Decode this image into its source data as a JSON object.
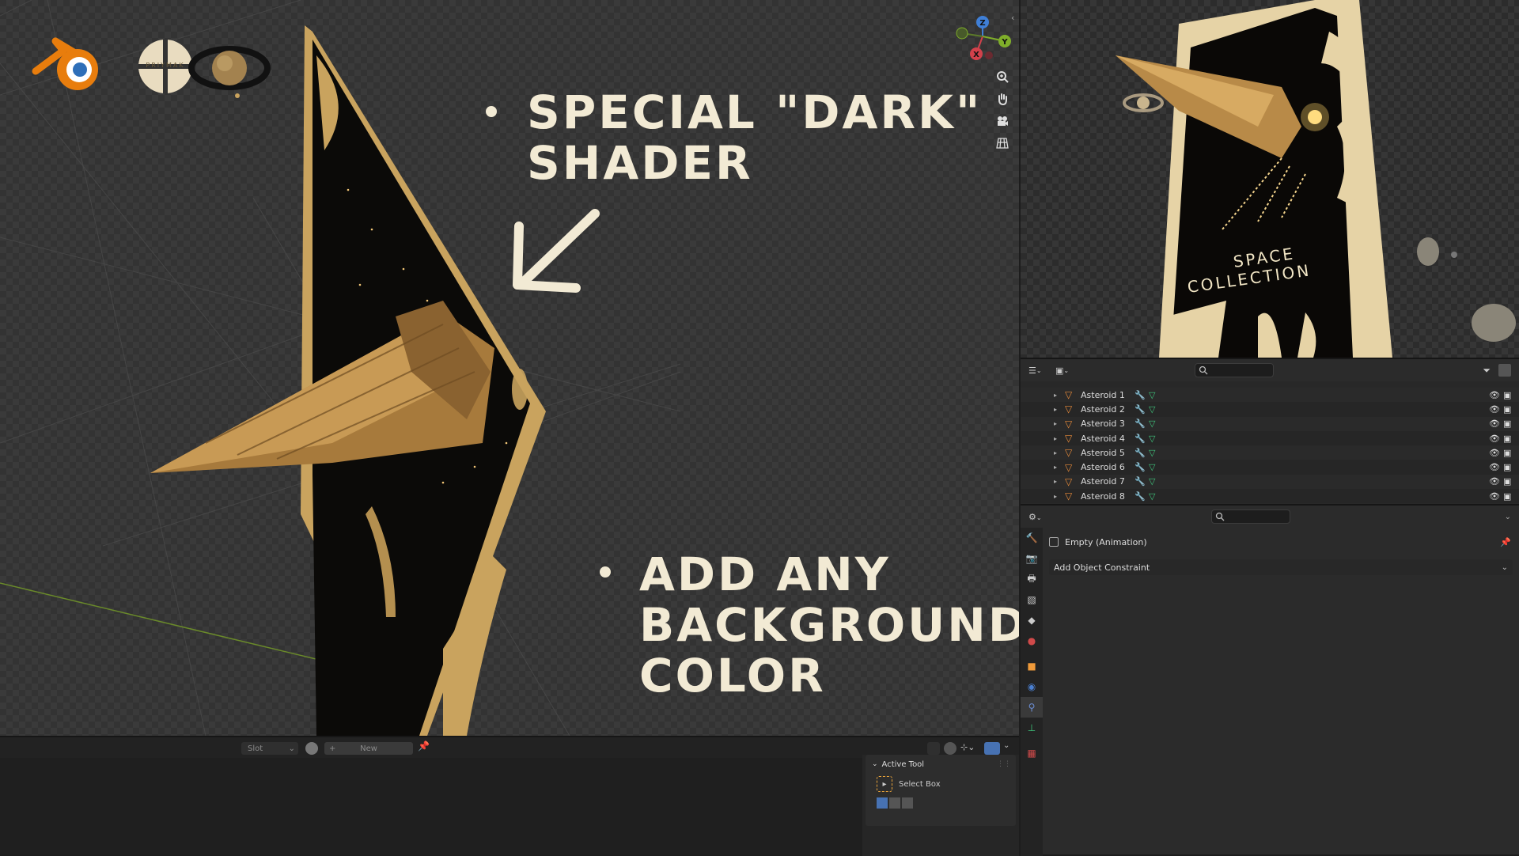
{
  "viewport": {
    "annotation_1_line1": "SPECIAL \"DARK\"",
    "annotation_1_line2": "SHADER",
    "annotation_2_line1": "ADD ANY",
    "annotation_2_line2": "BACKGROUND",
    "annotation_2_line3": "COLOR",
    "logo_text": "PRIYMAK",
    "gizmo": {
      "x": "X",
      "y": "Y",
      "z": "Z"
    },
    "icons": [
      "zoom-icon",
      "hand-pan-icon",
      "camera-icon",
      "grid-ortho-icon"
    ]
  },
  "render_preview": {
    "poster_text_line1": "SPACE",
    "poster_text_line2": "COLLECTION"
  },
  "outliner": {
    "items": [
      {
        "label": "Asteroid 1"
      },
      {
        "label": "Asteroid 2"
      },
      {
        "label": "Asteroid 3"
      },
      {
        "label": "Asteroid 4"
      },
      {
        "label": "Asteroid 5"
      },
      {
        "label": "Asteroid 6"
      },
      {
        "label": "Asteroid 7"
      },
      {
        "label": "Asteroid 8"
      }
    ]
  },
  "properties": {
    "object_name": "Empty (Animation)",
    "add_constraint_label": "Add Object Constraint"
  },
  "bottom_editor": {
    "slot_label": "Slot",
    "new_label": "New",
    "active_tool_title": "Active Tool",
    "select_box_label": "Select Box"
  },
  "colors": {
    "accent_blue": "#4772b3",
    "gold": "#c9a35e",
    "annotation": "#f2ead4",
    "blender_orange": "#e87d0d"
  }
}
